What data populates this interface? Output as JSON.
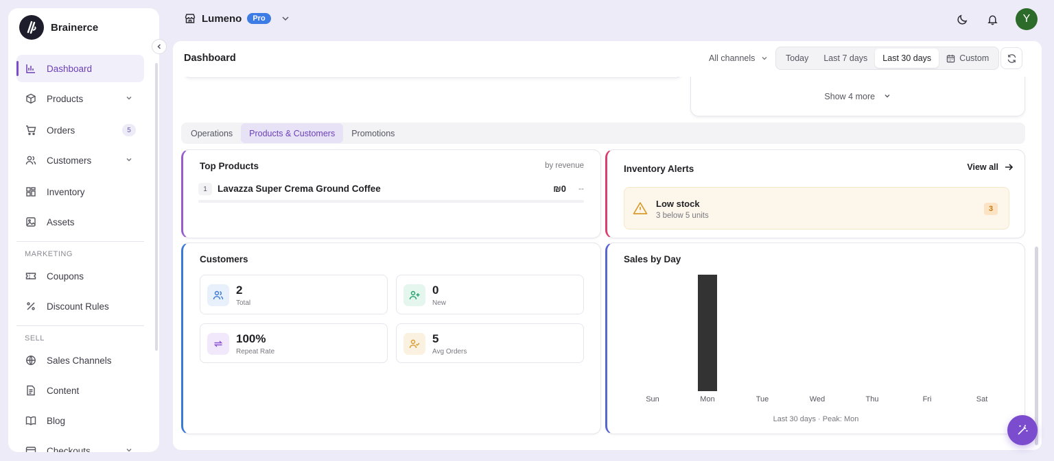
{
  "brand": {
    "name": "Brainerce"
  },
  "store": {
    "name": "Lumeno",
    "plan": "Pro"
  },
  "user": {
    "initial": "Y",
    "avatar_color": "#2d6b2a"
  },
  "sidebar": {
    "items": [
      {
        "label": "Dashboard",
        "icon": "bar-chart-icon",
        "active": true
      },
      {
        "label": "Products",
        "icon": "box-icon",
        "expandable": true
      },
      {
        "label": "Orders",
        "icon": "cart-icon",
        "badge": "5"
      },
      {
        "label": "Customers",
        "icon": "users-icon",
        "expandable": true
      },
      {
        "label": "Inventory",
        "icon": "grid-icon"
      },
      {
        "label": "Assets",
        "icon": "image-icon"
      }
    ],
    "sections": [
      {
        "title": "MARKETING",
        "items": [
          {
            "label": "Coupons",
            "icon": "ticket-icon"
          },
          {
            "label": "Discount Rules",
            "icon": "percent-icon"
          }
        ]
      },
      {
        "title": "SELL",
        "items": [
          {
            "label": "Sales Channels",
            "icon": "globe-icon"
          },
          {
            "label": "Content",
            "icon": "document-icon"
          },
          {
            "label": "Blog",
            "icon": "book-icon"
          },
          {
            "label": "Checkouts",
            "icon": "card-icon",
            "expandable": true
          }
        ]
      }
    ]
  },
  "header": {
    "title": "Dashboard",
    "channel": "All channels",
    "ranges": [
      "Today",
      "Last 7 days",
      "Last 30 days",
      "Custom"
    ],
    "selected_range": "Last 30 days"
  },
  "show_more": "Show 4 more",
  "tabs": [
    "Operations",
    "Products & Customers",
    "Promotions"
  ],
  "selected_tab": "Products & Customers",
  "top_products": {
    "title": "Top Products",
    "subtitle": "by revenue",
    "items": [
      {
        "rank": "1",
        "name": "Lavazza Super Crema Ground Coffee",
        "value": "₪0",
        "delta": "--"
      }
    ]
  },
  "inventory_alerts": {
    "title": "Inventory Alerts",
    "view_all": "View all",
    "alerts": [
      {
        "title": "Low stock",
        "subtitle": "3 below 5 units",
        "count": "3"
      }
    ]
  },
  "customers": {
    "title": "Customers",
    "stats": [
      {
        "value": "2",
        "label": "Total",
        "icon": "users-icon",
        "color": "#3b79d6"
      },
      {
        "value": "0",
        "label": "New",
        "icon": "user-plus-icon",
        "color": "#22a06b"
      },
      {
        "value": "100%",
        "label": "Repeat Rate",
        "icon": "repeat-icon",
        "color": "#8a4fd0"
      },
      {
        "value": "5",
        "label": "Avg Orders",
        "icon": "user-check-icon",
        "color": "#d99a2b"
      }
    ]
  },
  "sales_by_day": {
    "title": "Sales by Day",
    "footer": "Last 30 days · Peak: Mon"
  },
  "chart_data": {
    "type": "bar",
    "title": "Sales by Day",
    "categories": [
      "Sun",
      "Mon",
      "Tue",
      "Wed",
      "Thu",
      "Fri",
      "Sat"
    ],
    "values": [
      0,
      1,
      0,
      0,
      0,
      0,
      0
    ],
    "xlabel": "",
    "ylabel": "",
    "ylim": [
      0,
      1
    ],
    "grid": false,
    "bar_color": "#333333"
  }
}
